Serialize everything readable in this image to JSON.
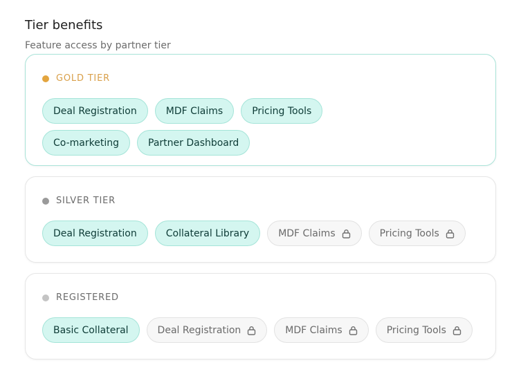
{
  "header": {
    "title": "Tier benefits",
    "subtitle": "Feature access by partner tier"
  },
  "colors": {
    "gold": "#e3a53f",
    "silver": "#9a9a9a",
    "registered": "#c4c4c4",
    "enabled_bg": "#d4f6f0",
    "locked_bg": "#f7f7f7"
  },
  "tiers": [
    {
      "name": "GOLD TIER",
      "features": [
        {
          "label": "Deal Registration",
          "locked": false
        },
        {
          "label": "MDF Claims",
          "locked": false
        },
        {
          "label": "Pricing Tools",
          "locked": false
        },
        {
          "label": "Co-marketing",
          "locked": false
        },
        {
          "label": "Partner Dashboard",
          "locked": false
        }
      ]
    },
    {
      "name": "SILVER TIER",
      "features": [
        {
          "label": "Deal Registration",
          "locked": false
        },
        {
          "label": "Collateral Library",
          "locked": false
        },
        {
          "label": "MDF Claims",
          "locked": true,
          "icon": "lock-icon"
        },
        {
          "label": "Pricing Tools",
          "locked": true,
          "icon": "lock-icon"
        }
      ]
    },
    {
      "name": "REGISTERED",
      "features": [
        {
          "label": "Basic Collateral",
          "locked": false
        },
        {
          "label": "Deal Registration",
          "locked": true,
          "icon": "lock-icon"
        },
        {
          "label": "MDF Claims",
          "locked": true,
          "icon": "lock-icon"
        },
        {
          "label": "Pricing Tools",
          "locked": true,
          "icon": "lock-icon"
        }
      ]
    }
  ]
}
